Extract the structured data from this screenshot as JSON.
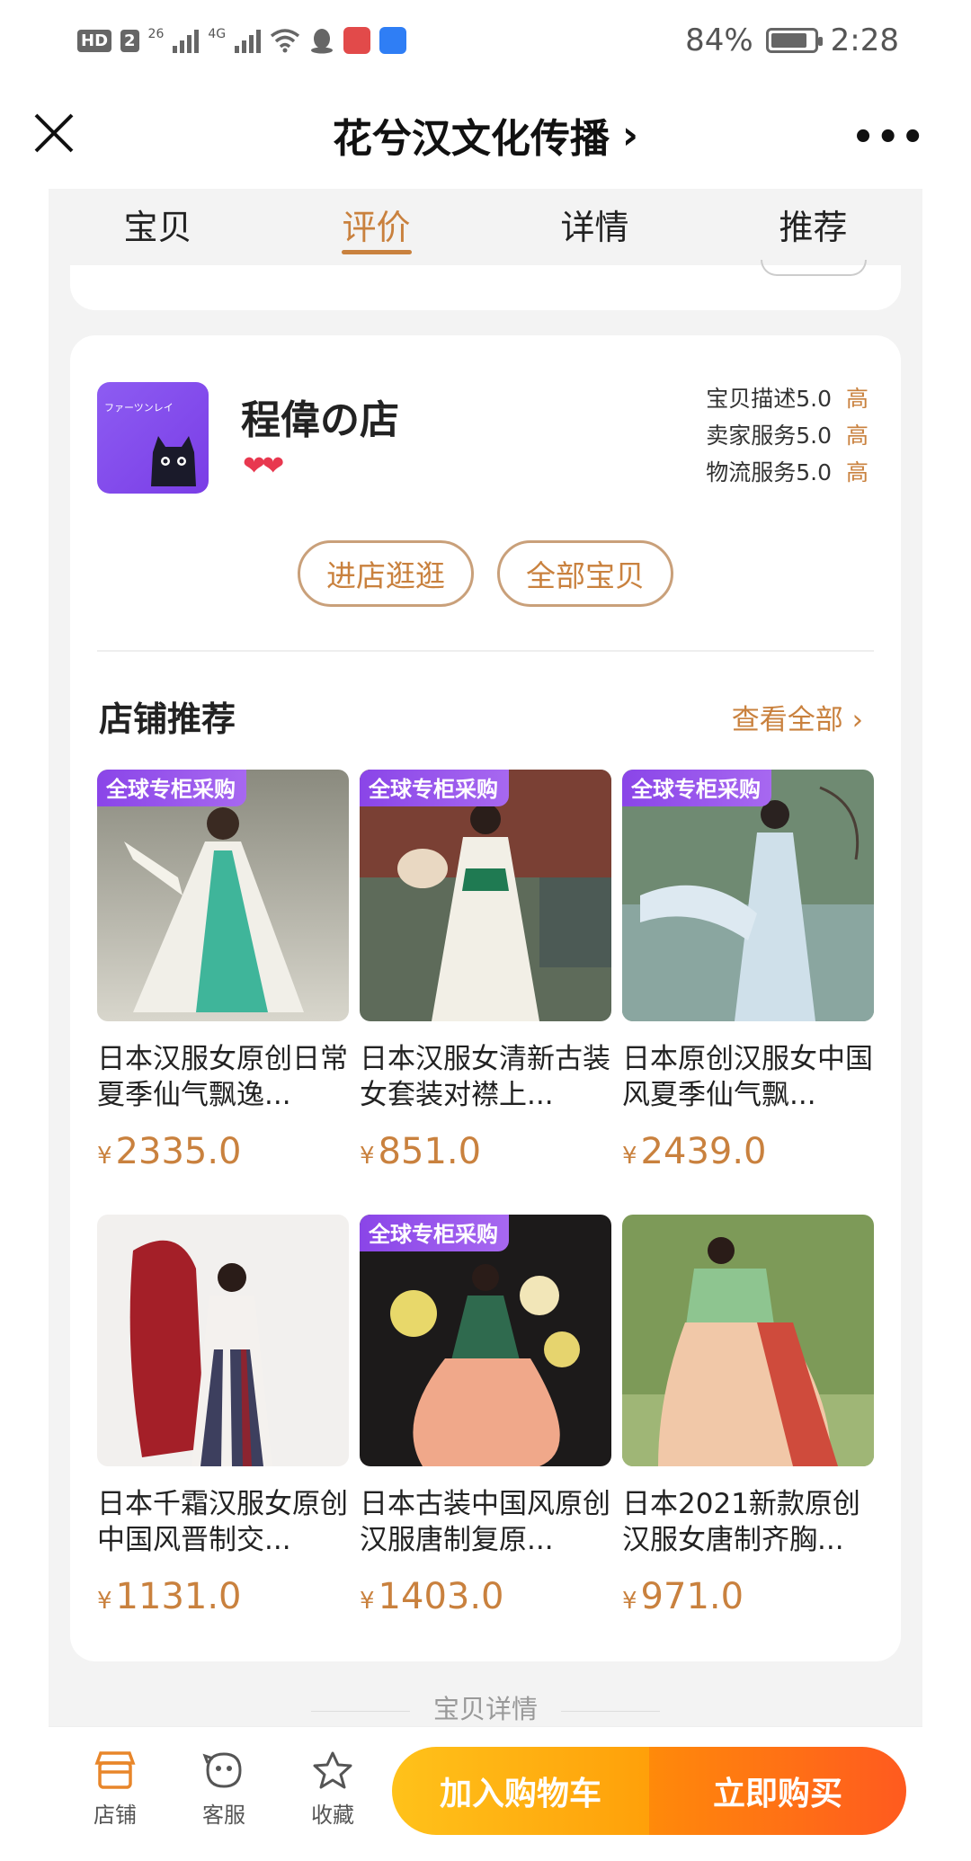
{
  "status_bar": {
    "hd": "HD",
    "sim": "2",
    "net1": "26",
    "net2": "4G",
    "battery": "84%",
    "battery_level": 0.84,
    "time": "2:28"
  },
  "header": {
    "title": "花兮汉文化传播",
    "chevron": "›",
    "more": "•••"
  },
  "tabs": [
    {
      "label": "宝贝",
      "active": false
    },
    {
      "label": "评价",
      "active": true
    },
    {
      "label": "详情",
      "active": false
    },
    {
      "label": "推荐",
      "active": false
    }
  ],
  "store": {
    "name": "程偉の店",
    "logo_text": "ファーツンレイ",
    "hearts": "❤❤",
    "ratings": [
      {
        "label": "宝贝描述",
        "score": "5.0",
        "level": "高"
      },
      {
        "label": "卖家服务",
        "score": "5.0",
        "level": "高"
      },
      {
        "label": "物流服务",
        "score": "5.0",
        "level": "高"
      }
    ],
    "enter_store": "进店逛逛",
    "all_items": "全部宝贝"
  },
  "recommend": {
    "title": "店铺推荐",
    "view_all": "查看全部 ›",
    "products": [
      {
        "badge": "全球专柜采购",
        "name": "日本汉服女原创日常夏季仙气飘逸...",
        "currency": "¥",
        "price": "2335.0"
      },
      {
        "badge": "全球专柜采购",
        "name": "日本汉服女清新古装女套装对襟上...",
        "currency": "¥",
        "price": "851.0"
      },
      {
        "badge": "全球专柜采购",
        "name": "日本原创汉服女中国风夏季仙气飘...",
        "currency": "¥",
        "price": "2439.0"
      },
      {
        "badge": "",
        "name": "日本千霜汉服女原创中国风晋制交...",
        "currency": "¥",
        "price": "1131.0"
      },
      {
        "badge": "全球专柜采购",
        "name": "日本古装中国风原创汉服唐制复原...",
        "currency": "¥",
        "price": "1403.0"
      },
      {
        "badge": "",
        "name": "日本2021新款原创汉服女唐制齐胸...",
        "currency": "¥",
        "price": "971.0"
      }
    ]
  },
  "detail_label": "宝贝详情",
  "bottom_bar": {
    "store": "店铺",
    "service": "客服",
    "favorite": "收藏",
    "add_cart": "加入购物车",
    "buy_now": "立即购买"
  },
  "colors": {
    "accent": "#c9813e",
    "badge": "#8a45e8",
    "cart": "#ffb012",
    "buy": "#ff6a14"
  }
}
